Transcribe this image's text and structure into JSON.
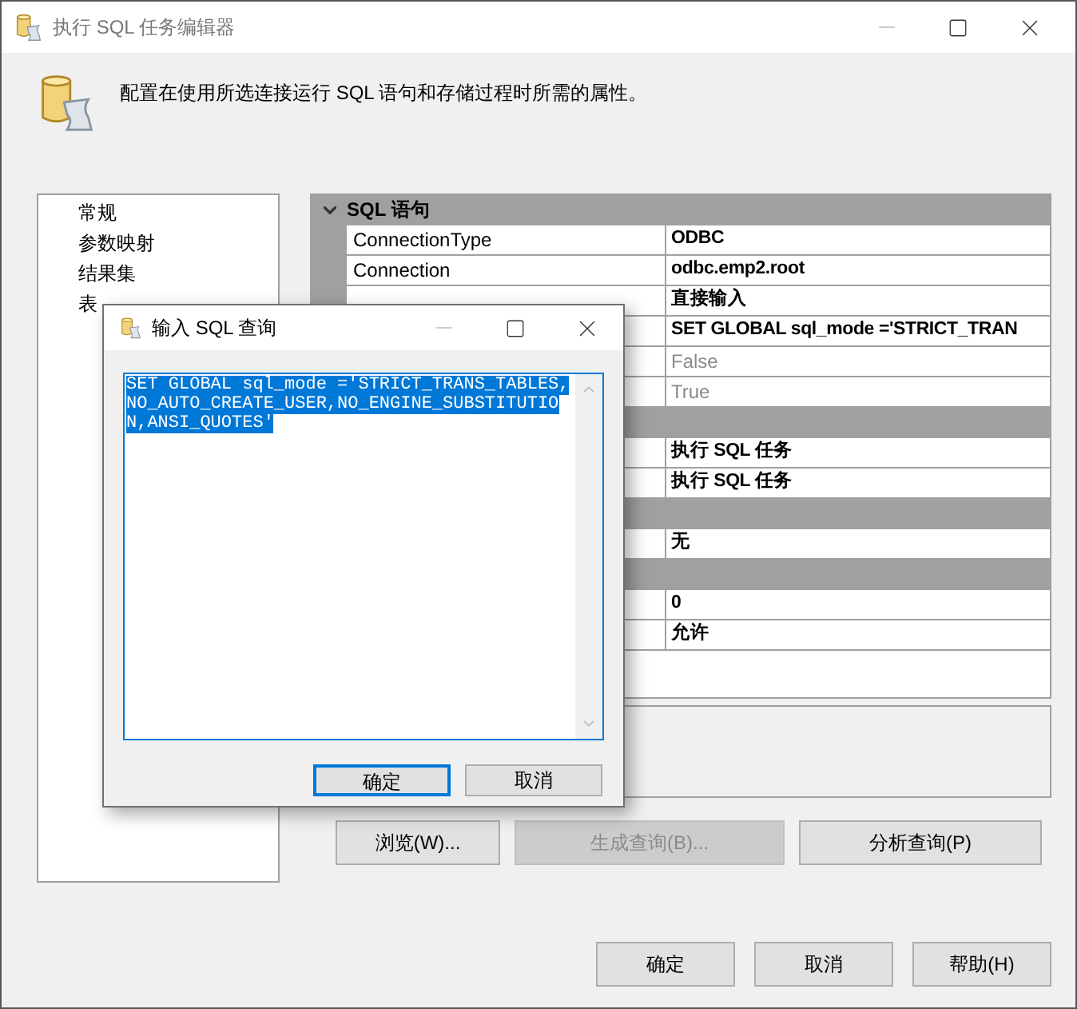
{
  "window": {
    "title": "执行 SQL 任务编辑器"
  },
  "header": {
    "description": "配置在使用所选连接运行 SQL 语句和存储过程时所需的属性。"
  },
  "nav": {
    "items": [
      {
        "label": "常规",
        "selected": false
      },
      {
        "label": "参数映射",
        "selected": false
      },
      {
        "label": "结果集",
        "selected": false
      },
      {
        "label": "表",
        "selected": false
      }
    ]
  },
  "grid": {
    "rows": [
      {
        "kind": "category",
        "label": "SQL 语句",
        "expanded": true
      },
      {
        "kind": "property",
        "name": "ConnectionType",
        "value": "ODBC",
        "disabled": false
      },
      {
        "kind": "property",
        "name": "Connection",
        "value": "odbc.emp2.root",
        "disabled": false
      },
      {
        "kind": "property",
        "value": "直接输入",
        "disabled": false
      },
      {
        "kind": "property",
        "value": "SET GLOBAL sql_mode ='STRICT_TRAN",
        "disabled": false
      },
      {
        "kind": "property",
        "value": "False",
        "disabled": true
      },
      {
        "kind": "property",
        "value": "True",
        "disabled": true
      },
      {
        "kind": "category"
      },
      {
        "kind": "property",
        "value": "执行 SQL 任务",
        "disabled": false
      },
      {
        "kind": "property",
        "value": "执行 SQL 任务",
        "disabled": false
      },
      {
        "kind": "category"
      },
      {
        "kind": "property",
        "value": "无",
        "disabled": false
      },
      {
        "kind": "category"
      },
      {
        "kind": "property",
        "value": "0",
        "disabled": false
      },
      {
        "kind": "property",
        "value": "允许",
        "disabled": false
      }
    ]
  },
  "buttons": [
    {
      "label": "浏览(W)...",
      "disabled": false
    },
    {
      "label": "生成查询(B)...",
      "disabled": true
    },
    {
      "label": "分析查询(P)",
      "disabled": false
    }
  ],
  "footer_buttons": [
    "确定",
    "取消",
    "帮助(H)"
  ],
  "dialog": {
    "title": "输入 SQL 查询",
    "query": "SET GLOBAL sql_mode ='STRICT_TRANS_TABLES,NO_AUTO_CREATE_USER,NO_ENGINE_SUBSTITUTION,ANSI_QUOTES'",
    "buttons": [
      {
        "label": "确定",
        "default": true
      },
      {
        "label": "取消",
        "default": false
      }
    ]
  }
}
